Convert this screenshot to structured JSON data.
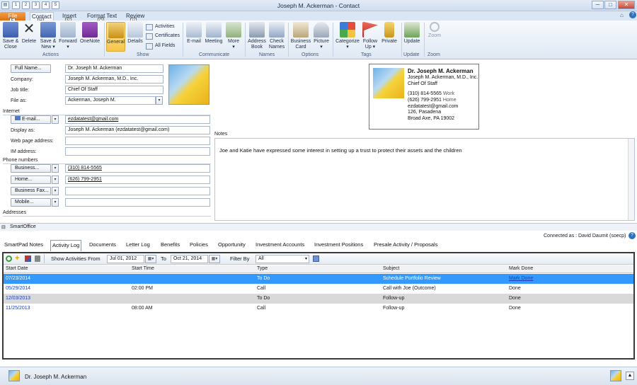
{
  "window": {
    "title": "Joseph M. Ackerman  -  Contact",
    "qa_tips": [
      "1",
      "2",
      "3",
      "4",
      "5"
    ],
    "min": "─",
    "max": "□",
    "close": "✕"
  },
  "ribbon_tabs": [
    {
      "label": "File",
      "tip": "F"
    },
    {
      "label": "Contact",
      "tip": "H"
    },
    {
      "label": "Insert",
      "tip": "N"
    },
    {
      "label": "Format Text",
      "tip": "O"
    },
    {
      "label": "Review",
      "tip": "V"
    }
  ],
  "ribbon": {
    "save_close": "Save &\nClose",
    "delete": "Delete",
    "save_new": "Save &\nNew ▾",
    "forward": "Forward\n▾",
    "onenote": "OneNote",
    "general": "General",
    "details": "Details",
    "activities": "Activities",
    "certificates": "Certificates",
    "all_fields": "All Fields",
    "email": "E-mail",
    "meeting": "Meeting",
    "more": "More\n▾",
    "address_book": "Address\nBook",
    "check_names": "Check\nNames",
    "business_card": "Business\nCard",
    "picture": "Picture\n▾",
    "categorize": "Categorize\n▾",
    "follow_up": "Follow\nUp ▾",
    "private": "Private",
    "update": "Update",
    "zoom": "Zoom",
    "groups": [
      "Actions",
      "Show",
      "Communicate",
      "Names",
      "Options",
      "Tags",
      "Update",
      "Zoom"
    ]
  },
  "form": {
    "full_name_btn": "Full Name...",
    "full_name": "Dr. Joseph M. Ackerman",
    "company_lbl": "Company:",
    "company": "Joseph M. Ackerman, M.D., Inc.",
    "jobtitle_lbl": "Job title:",
    "jobtitle": "Chief Of Staff",
    "fileas_lbl": "File as:",
    "fileas": "Ackerman, Joseph M.",
    "internet_lbl": "Internet",
    "email_btn": "E-mail...",
    "email": "ezdatatest@gmail.com",
    "displayas_lbl": "Display as:",
    "displayas": "Joseph M. Ackerman (ezdatatest@gmail.com)",
    "web_lbl": "Web page address:",
    "im_lbl": "IM address:",
    "phones_lbl": "Phone numbers",
    "business_btn": "Business...",
    "business_phone": "(310) 814-5565",
    "home_btn": "Home...",
    "home_phone": "(626) 799-2951",
    "fax_btn": "Business Fax...",
    "mobile_btn": "Mobile...",
    "addresses_lbl": "Addresses",
    "notes_lbl": "Notes",
    "notes_text": "Joe and Katie have expressed some interest in setting up a trust to protect their assets and the children"
  },
  "card": {
    "name": "Dr. Joseph M. Ackerman",
    "company": "Joseph M. Ackerman, M.D., Inc.",
    "title": "Chief Of Staff",
    "phone_work": "(310) 814-5565",
    "work_lbl": "Work",
    "phone_home": "(626) 799-2951",
    "home_lbl": "Home",
    "email": "ezdatatest@gmail.com",
    "addr1": "126, Pasadena",
    "addr2": "Broad Axe, PA  19002"
  },
  "smartoffice": {
    "title": "SmartOffice",
    "connected": "Connected as : David Daumit (soecp)",
    "tabs": [
      "SmartPad Notes",
      "Activity Log",
      "Documents",
      "Letter Log",
      "Benefits",
      "Policies",
      "Opportunity",
      "Investment Accounts",
      "Investment Positions",
      "Presale Activity / Proposals"
    ],
    "show_from_lbl": "Show Activities From",
    "from_date": "Jul  01, 2012",
    "to_lbl": "To",
    "to_date": "Oct  21, 2014",
    "filter_lbl": "Filter By",
    "filter_value": "All",
    "columns": [
      "Start Date",
      "Start Time",
      "Type",
      "Subject",
      "Mark Done"
    ],
    "rows": [
      {
        "date": "07/23/2014",
        "time": "",
        "type": "To Do",
        "subject": "Schedule Portfolio Review",
        "done": "Mark Done"
      },
      {
        "date": "05/29/2014",
        "time": "02:00 PM",
        "type": "Call",
        "subject": "Call with Joe (Outcome)",
        "done": "Done"
      },
      {
        "date": "12/03/2013",
        "time": "",
        "type": "To Do",
        "subject": "Follow-up",
        "done": "Done"
      },
      {
        "date": "11/25/2013",
        "time": "08:00 AM",
        "type": "Call",
        "subject": "Follow-up",
        "done": "Done"
      }
    ]
  },
  "status": {
    "name": "Dr. Joseph M. Ackerman"
  }
}
